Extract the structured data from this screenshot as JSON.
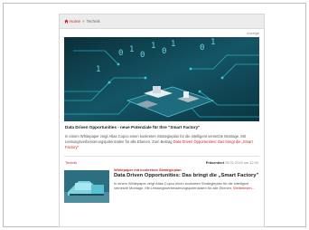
{
  "breadcrumb": {
    "home": "Home",
    "separator": "»",
    "current": "Technik"
  },
  "ad_label": "Anzeige",
  "hero": {
    "title": "Data Driven Opportunities - neue Potenziale für Ihre \"Smart Factory\"",
    "text": "In einem Whitepaper zeigt Atlas Copco einen konkreten Strategieplan für die intelligent vernetzte Montage. Mit Leistungsverbesserungspotenzialen für alle Ebenen. Zum Beitrag",
    "link": "Data Driven Opportunities: Das bringt die „Smart Factory\""
  },
  "sponsor": {
    "tag": "Technik",
    "label": "Präsentiert",
    "date": "05.01.2019 um 12:00"
  },
  "teaser": {
    "kicker": "Whitepaper mit konkretem Strategieplan",
    "title": "Data Driven Opportunities: Das bringt die „Smart Factory\"",
    "text": "In einem Whitepaper zeigt Atlas Copco einen konkreten Strategieplan für die intelligent vernetzte Montage. Mit Leistungsverbesserungspotenzialen für alle Ebenen.",
    "more": "Weiterlesen..."
  },
  "colors": {
    "accent": "#c62828",
    "hero_bg": "#0d3b45"
  },
  "icons": {
    "home": "home-icon"
  }
}
